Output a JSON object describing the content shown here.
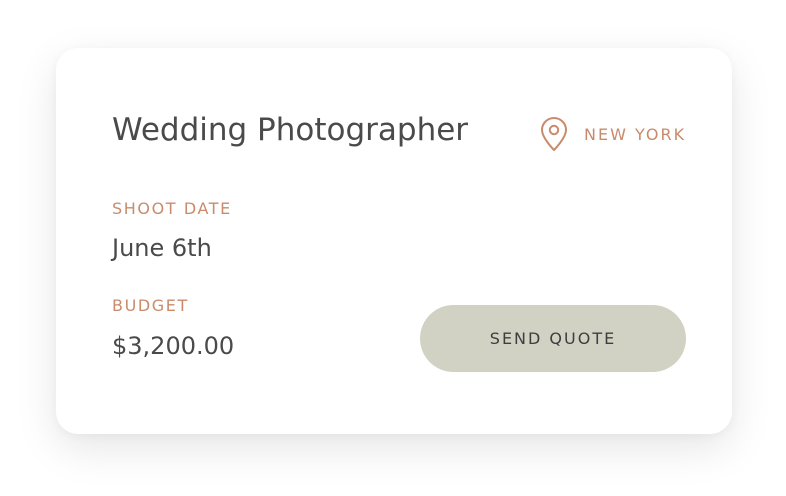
{
  "listing": {
    "title": "Wedding Photographer",
    "location": {
      "icon": "map-pin-icon",
      "label": "NEW YORK"
    },
    "shoot_date": {
      "label": "SHOOT DATE",
      "value": "June 6th"
    },
    "budget": {
      "label": "BUDGET",
      "value": "$3,200.00"
    },
    "action": {
      "label": "SEND QUOTE"
    }
  },
  "colors": {
    "accent": "#c98b6b",
    "text": "#4a4a4a",
    "button_bg": "#d1d1c4",
    "card_bg": "#ffffff"
  }
}
